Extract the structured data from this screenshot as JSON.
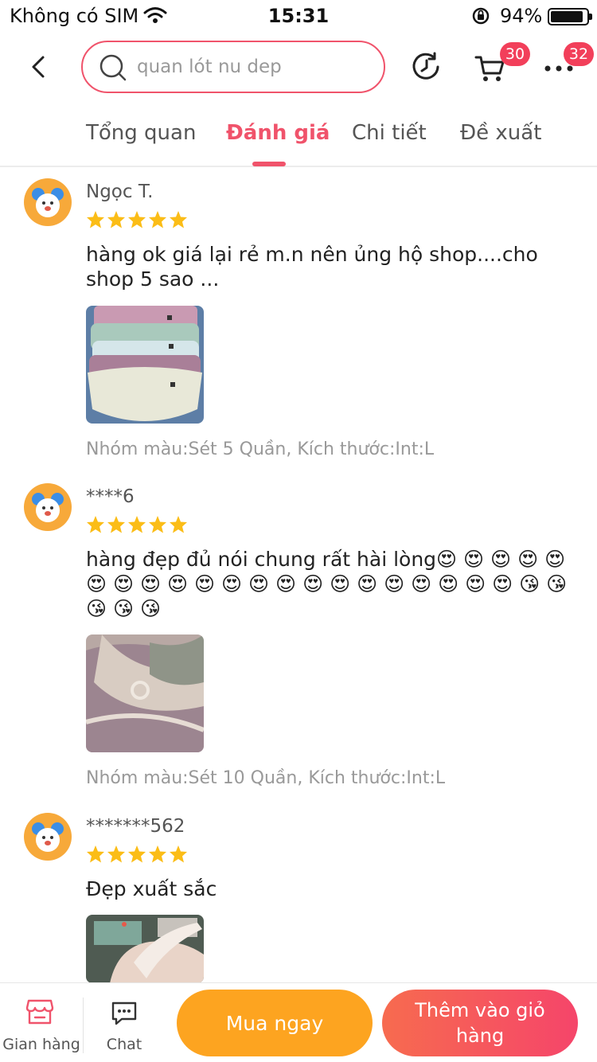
{
  "status_bar": {
    "carrier": "Không có SIM",
    "time": "15:31",
    "battery": "94%",
    "battery_level": 0.94
  },
  "header": {
    "search": {
      "placeholder": "quan lót nu dep"
    },
    "cart_badge": "30",
    "more_badge": "32",
    "icons": [
      "back-icon",
      "search-icon",
      "history-icon",
      "cart-icon",
      "more-icon"
    ]
  },
  "tabs": [
    {
      "label": "Tổng quan",
      "active": false
    },
    {
      "label": "Đánh giá",
      "active": true
    },
    {
      "label": "Chi tiết",
      "active": false
    },
    {
      "label": "Đề xuất",
      "active": false
    }
  ],
  "reviews": [
    {
      "name": "Ngọc T.",
      "rating": 5,
      "text": "hàng ok giá lại rẻ m.n nên ủng hộ shop....cho shop 5 sao ...",
      "variant": "Nhóm màu:Sét 5 Quần, Kích thước:Int:L"
    },
    {
      "name": "****6",
      "rating": 5,
      "text": "hàng đẹp đủ nói chung rất hài lòng😍 😍 😍 😍 😍 😍 😍 😍 😍 😍 😍 😍 😍 😍 😍 😍 😍 😍 😍 😍 😍 😘 😘 😘 😘 😘",
      "variant": "Nhóm màu:Sét 10 Quần, Kích thước:Int:L"
    },
    {
      "name": "*******562",
      "rating": 5,
      "text": "Đẹp xuất sắc",
      "variant": ""
    }
  ],
  "bottom_bar": {
    "store_label": "Gian hàng",
    "chat_label": "Chat",
    "buy_now": "Mua ngay",
    "add_to_cart": "Thêm vào giỏ hàng"
  },
  "colors": {
    "accent": "#f0536b",
    "badge": "#f23f5a",
    "star": "#fbbd17",
    "buy_now": "#fda420",
    "add_to_cart_start": "#f76b4f",
    "add_to_cart_end": "#f5456a"
  }
}
